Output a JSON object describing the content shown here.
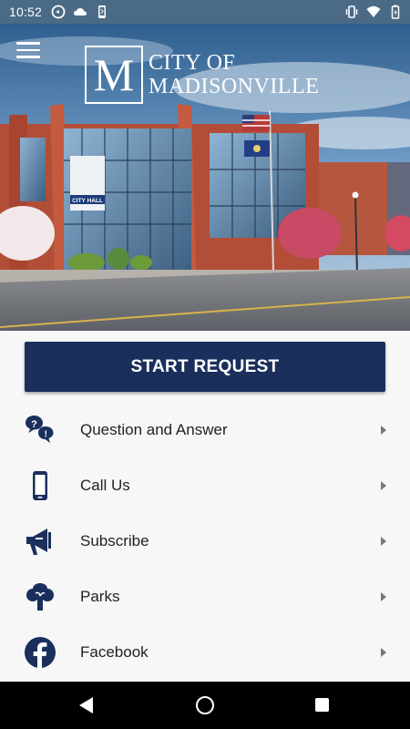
{
  "status_bar": {
    "time": "10:52",
    "left_icons": [
      "vpn-key-icon",
      "cloud-icon",
      "phone-sync-icon"
    ],
    "right_icons": [
      "vibrate-icon",
      "wifi-icon",
      "battery-icon"
    ]
  },
  "header": {
    "logo_letter": "M",
    "logo_line1": "CITY OF",
    "logo_line2": "MADISONVILLE",
    "sign_text": "CITY HALL"
  },
  "primary_action": {
    "label": "START REQUEST"
  },
  "menu": [
    {
      "label": "Question and Answer",
      "icon": "question-answer-icon"
    },
    {
      "label": "Call Us",
      "icon": "mobile-phone-icon"
    },
    {
      "label": "Subscribe",
      "icon": "megaphone-icon"
    },
    {
      "label": "Parks",
      "icon": "tree-icon"
    },
    {
      "label": "Facebook",
      "icon": "facebook-icon"
    }
  ],
  "colors": {
    "status_bar": "#4a6a86",
    "primary_button": "#1b2f5d",
    "icon": "#1b2f5d",
    "background": "#f7f7f7"
  }
}
